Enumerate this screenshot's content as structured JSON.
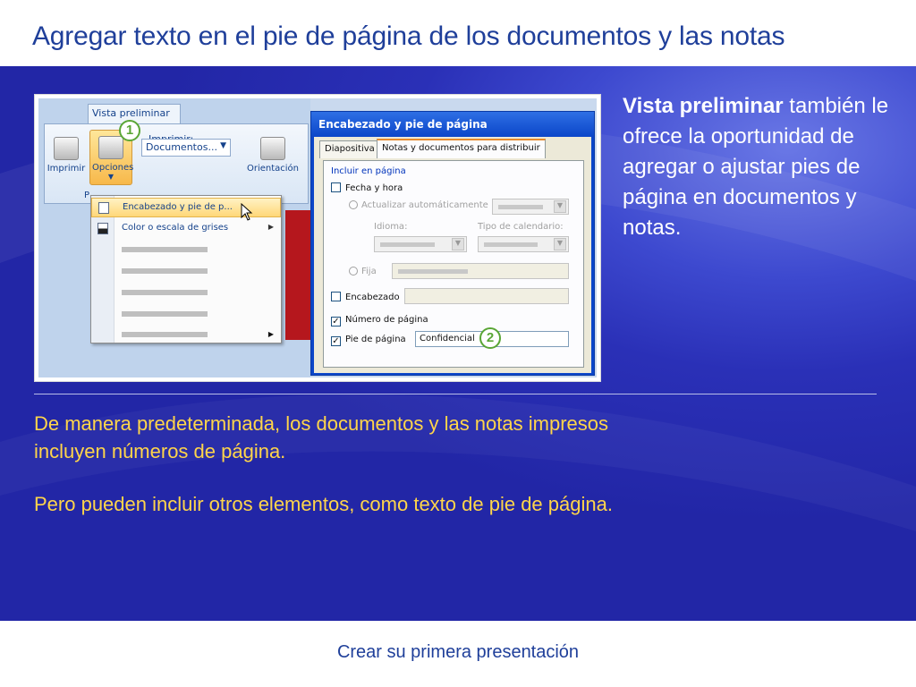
{
  "slide": {
    "title": "Agregar texto en el pie de página de los documentos y las notas",
    "footer": "Crear su primera presentación",
    "side_bold": "Vista preliminar",
    "side_text": " también le ofrece la oportunidad de agregar o ajustar pies de página en documentos y notas.",
    "para1": "De manera predeterminada, los documentos y las notas impresos incluyen números de página.",
    "para2": "Pero pueden incluir otros elementos, como texto de pie de página."
  },
  "screenshot": {
    "ribbon_tab": "Vista preliminar",
    "imprimir_btn": "Imprimir",
    "opciones_btn": "Opciones",
    "imprimir_label": "Imprimir:",
    "documentos_value": "Documentos...",
    "orientacion_btn": "Orientación",
    "group_letter": "P",
    "menu_items": [
      "Encabezado y pie de p...",
      "Color o escala de grises"
    ],
    "badge1": "1",
    "badge2": "2",
    "dialog": {
      "title": "Encabezado y pie de página",
      "tabs": [
        "Diapositiva",
        "Notas y documentos para distribuir"
      ],
      "group_label": "Incluir en página",
      "fecha_hora": "Fecha y hora",
      "actualizar": "Actualizar automáticamente",
      "idioma": "Idioma:",
      "tipo_calendario": "Tipo de calendario:",
      "fija": "Fija",
      "encabezado": "Encabezado",
      "numero_pagina": "Número de página",
      "pie_pagina": "Pie de página",
      "pie_value": "Confidencial",
      "check_mark": "✓"
    }
  },
  "colors": {
    "title": "#1f3f9a",
    "body_bg": "#2a30b7",
    "yellow_text": "#ffd54a",
    "badge": "#5aa636"
  }
}
